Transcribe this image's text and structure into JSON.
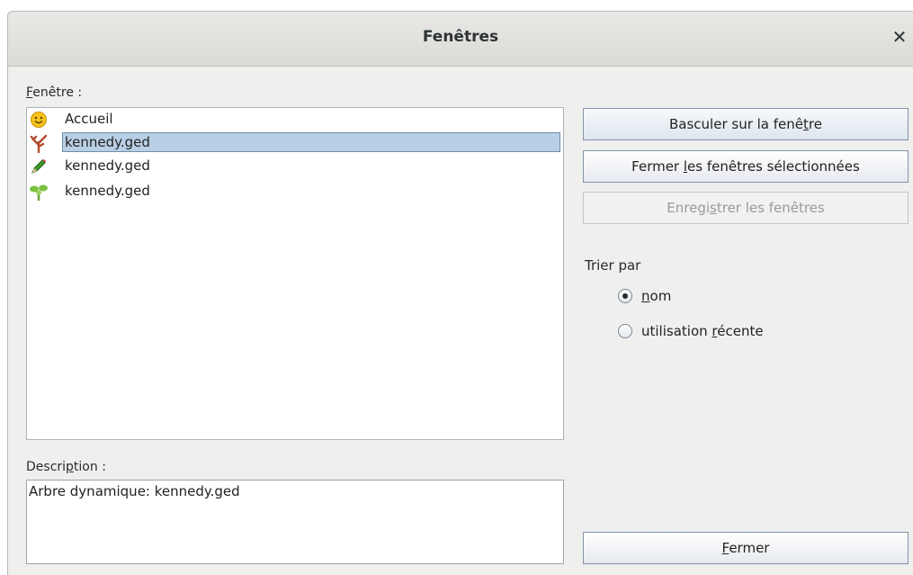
{
  "dialog": {
    "title": "Fenêtres"
  },
  "window_list": {
    "label_first": "F",
    "label_rest": "enêtre :",
    "items": [
      {
        "label": "Accueil",
        "icon": "smiley-icon"
      },
      {
        "label": "kennedy.ged",
        "icon": "dynamic-tree-icon",
        "selected": true
      },
      {
        "label": "kennedy.ged",
        "icon": "pencil-icon"
      },
      {
        "label": "kennedy.ged",
        "icon": "green-tree-icon"
      }
    ]
  },
  "buttons": {
    "switch": {
      "before": "Basculer sur la fenê",
      "u": "t",
      "after": "re"
    },
    "close_selected": {
      "before": "Fermer ",
      "u": "l",
      "after": "es fenêtres sélectionnées"
    },
    "save": {
      "before": "Enregi",
      "u": "s",
      "after": "trer les fenêtres"
    },
    "close": {
      "before": "",
      "u": "F",
      "after": "ermer"
    }
  },
  "sort": {
    "label": "Trier par",
    "options": [
      {
        "before": "",
        "u": "n",
        "after": "om",
        "checked": true
      },
      {
        "before": "utilisation ",
        "u": "r",
        "after": "écente",
        "checked": false
      }
    ]
  },
  "description": {
    "label_before": "Descri",
    "label_u": "p",
    "label_after": "tion :",
    "text": "Arbre dynamique: kennedy.ged"
  },
  "colors": {
    "selection": "#b8cfe5",
    "selection_border": "#6f8fae"
  }
}
